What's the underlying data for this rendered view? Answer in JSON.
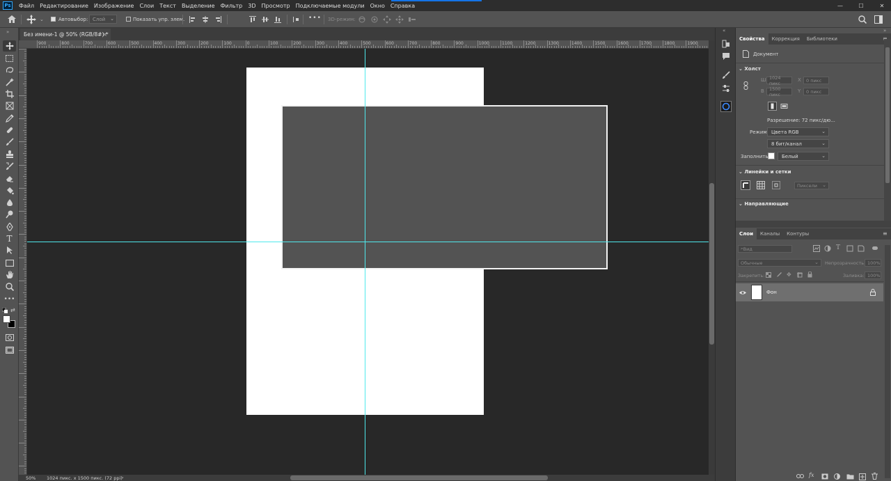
{
  "app": {
    "logo": "Ps",
    "menu": [
      "Файл",
      "Редактирование",
      "Изображение",
      "Слои",
      "Текст",
      "Выделение",
      "Фильтр",
      "3D",
      "Просмотр",
      "Подключаемые модули",
      "Окно",
      "Справка"
    ],
    "window_controls": {
      "minimize": "—",
      "maximize": "☐",
      "close": "✕"
    }
  },
  "options_bar": {
    "auto_select_label": "Автовыбор:",
    "auto_select_checked": true,
    "auto_select_target": "Слой",
    "show_transform_label": "Показать упр. элем.",
    "show_transform_checked": false,
    "more": "•••",
    "mode_3d_label": "3D-режим:"
  },
  "document_tab": {
    "title": "Без имени-1 @ 50% (RGB/8#) *",
    "close": "×"
  },
  "rulers": {
    "top_labels": [
      "900",
      "800",
      "700",
      "600",
      "500",
      "400",
      "300",
      "200",
      "100",
      "0",
      "100",
      "200",
      "300",
      "400",
      "500",
      "600",
      "700",
      "800",
      "900",
      "1000",
      "1100",
      "1200",
      "1300",
      "1400",
      "1500",
      "1600",
      "1700",
      "1800",
      "1900"
    ]
  },
  "status_bar": {
    "zoom": "50%",
    "doc_info": "1024 пикс. x 1500 пикс. (72 ppi)",
    "arrow": "›"
  },
  "properties_panel": {
    "tabs": [
      "Свойства",
      "Коррекция",
      "Библиотеки"
    ],
    "active_tab": "Свойства",
    "doc_type": "Документ",
    "canvas_section": "Холст",
    "width_label": "Ш",
    "width_value": "1024 пикс",
    "height_label": "В",
    "height_value": "1500 пикс",
    "x_label": "X",
    "x_value": "0 пикс",
    "y_label": "Y",
    "y_value": "0 пикс",
    "resolution": "Разрешение: 72 пикс/дю...",
    "mode_label": "Режим",
    "mode_value": "Цвета RGB",
    "depth_value": "8 бит/канал",
    "fill_label": "Заполнить",
    "fill_value": "Белый",
    "rulers_section": "Линейки и сетки",
    "units_value": "Пиксели",
    "guides_section": "Направляющие"
  },
  "layers_panel": {
    "tabs": [
      "Слои",
      "Каналы",
      "Контуры"
    ],
    "active_tab": "Слои",
    "filter_kind": "Вид",
    "blend_mode": "Обычные",
    "opacity_label": "Непрозрачность:",
    "opacity_value": "100%",
    "lock_label": "Закрепить:",
    "fill_label": "Заливка:",
    "fill_value": "100%",
    "layers": [
      {
        "name": "Фон",
        "visible": true,
        "locked": true
      }
    ]
  },
  "colors": {
    "accent": "#1473e6",
    "guide": "#4ee9ec",
    "canvas_bg": "#282828",
    "panel_bg": "#535353"
  }
}
